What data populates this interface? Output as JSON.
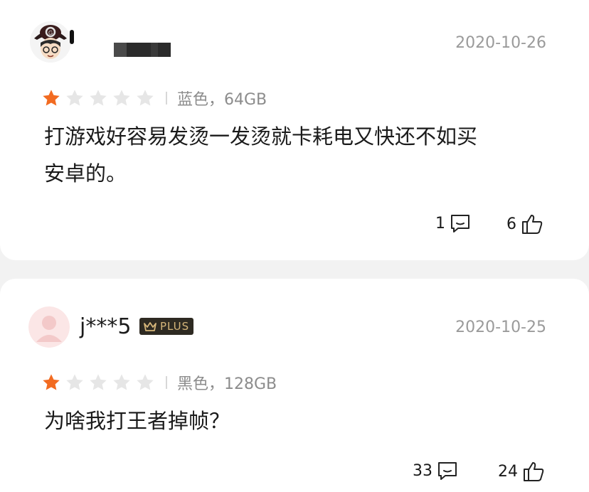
{
  "reviews": [
    {
      "username": "",
      "date": "2020-10-26",
      "rating": 1,
      "variant": "蓝色，64GB",
      "text_line1": "打游戏好容易发烫一发烫就卡耗电又快还不如买",
      "text_line2": "安卓的。",
      "comments": "1",
      "likes": "6"
    },
    {
      "username": "j***5",
      "badge": "PLUS",
      "date": "2020-10-25",
      "rating": 1,
      "variant": "黑色，128GB",
      "text_line1": "为啥我打王者掉帧？",
      "comments": "33",
      "likes": "24"
    }
  ],
  "colors": {
    "star_filled": "#f26b21",
    "star_empty": "#e6e6e6",
    "badge_bg": "#2e2a22",
    "badge_text": "#d6b67a"
  },
  "icons": [
    "comment-icon",
    "thumbs-up-icon",
    "crown-icon",
    "star-icon"
  ]
}
